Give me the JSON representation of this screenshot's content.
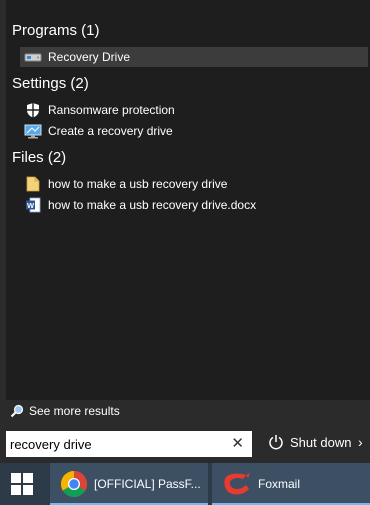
{
  "sections": {
    "programs": {
      "header": "Programs (1)",
      "items": [
        {
          "label": "Recovery Drive",
          "icon": "recovery-drive-icon"
        }
      ]
    },
    "settings": {
      "header": "Settings (2)",
      "items": [
        {
          "label": "Ransomware protection",
          "icon": "shield-icon"
        },
        {
          "label": "Create a recovery drive",
          "icon": "monitor-icon"
        }
      ]
    },
    "files": {
      "header": "Files (2)",
      "items": [
        {
          "label": "how to make a usb recovery drive",
          "icon": "file-icon"
        },
        {
          "label": "how to make a usb recovery drive.docx",
          "icon": "word-document-icon"
        }
      ]
    }
  },
  "see_more": "See more results",
  "search": {
    "value": "recovery drive",
    "clear": "✕"
  },
  "power": {
    "label": "Shut down",
    "arrow": "›"
  },
  "taskbar": {
    "apps": [
      {
        "label": "[OFFICIAL] PassF...",
        "icon": "chrome-icon"
      },
      {
        "label": "Foxmail",
        "icon": "foxmail-icon"
      }
    ]
  },
  "colors": {
    "selected_bg": "#3c3c3c",
    "taskbar_bg": "#2d3a47",
    "taskbar_active": "#3c4f63",
    "accent": "#76b9ed"
  }
}
